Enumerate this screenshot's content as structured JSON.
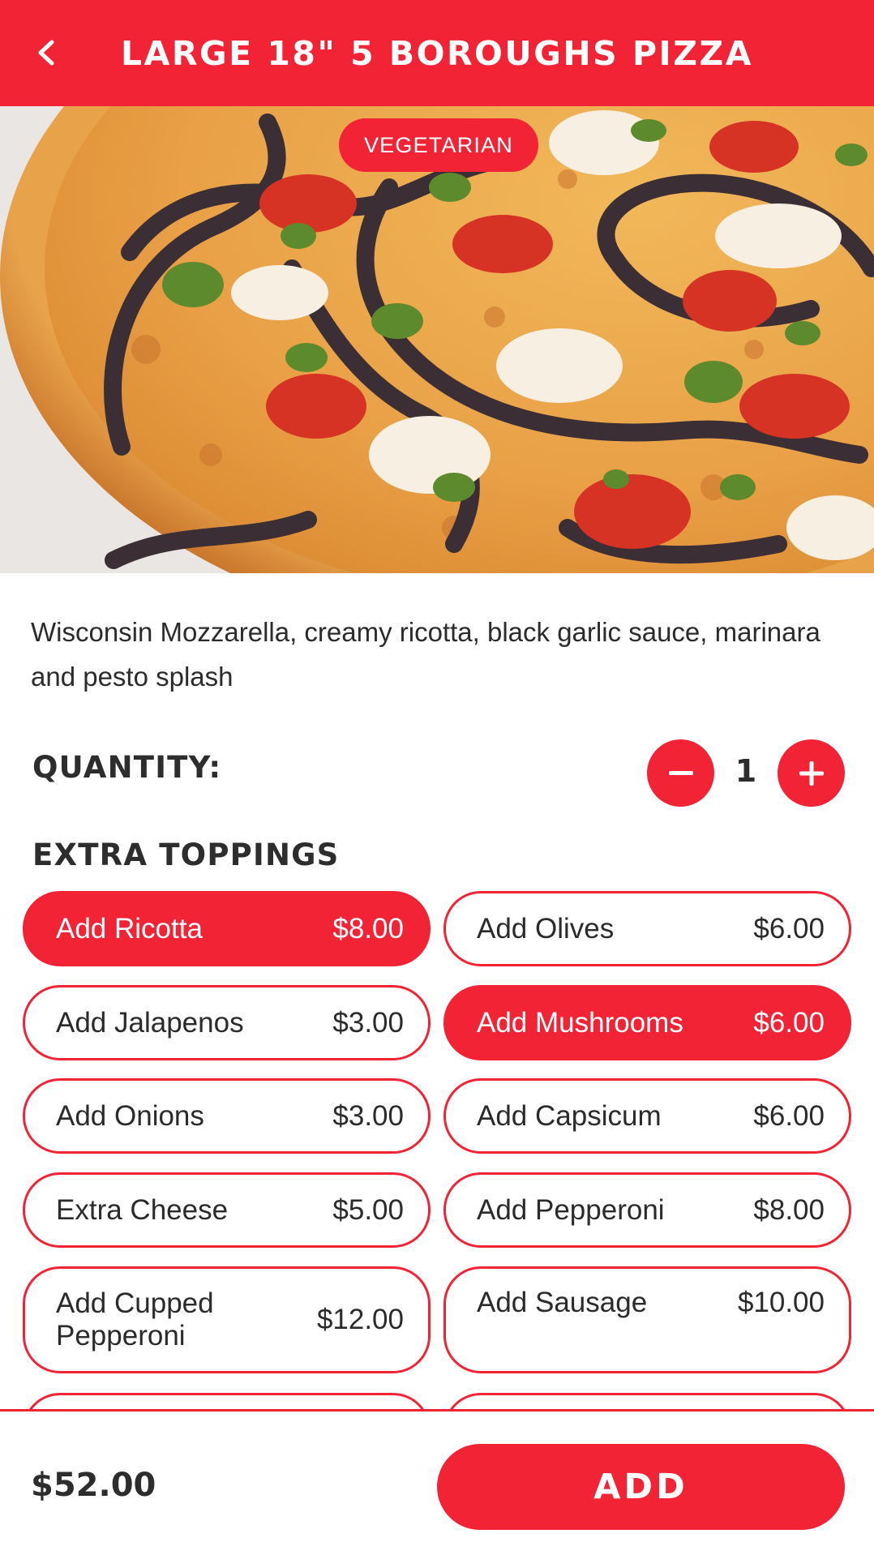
{
  "header": {
    "title": "LARGE 18\" 5 BOROUGHS PIZZA",
    "back_icon": "chevron-left-icon"
  },
  "badge": {
    "label": "VEGETARIAN"
  },
  "product": {
    "description": "Wisconsin Mozzarella, creamy ricotta, black garlic sauce, marinara and pesto splash"
  },
  "quantity": {
    "label": "QUANTITY:",
    "value": "1",
    "minus_icon": "minus-icon",
    "plus_icon": "plus-icon"
  },
  "toppings": {
    "title": "EXTRA TOPPINGS",
    "items": [
      {
        "name": "Add Ricotta",
        "price": "$8.00",
        "selected": true
      },
      {
        "name": "Add Olives",
        "price": "$6.00",
        "selected": false
      },
      {
        "name": "Add Jalapenos",
        "price": "$3.00",
        "selected": false
      },
      {
        "name": "Add Mushrooms",
        "price": "$6.00",
        "selected": true
      },
      {
        "name": "Add Onions",
        "price": "$3.00",
        "selected": false
      },
      {
        "name": "Add Capsicum",
        "price": "$6.00",
        "selected": false
      },
      {
        "name": "Extra Cheese",
        "price": "$5.00",
        "selected": false
      },
      {
        "name": "Add Pepperoni",
        "price": "$8.00",
        "selected": false
      },
      {
        "name": "Add Cupped Pepperoni",
        "price": "$12.00",
        "selected": false
      },
      {
        "name": "Add Sausage",
        "price": "$10.00",
        "selected": false
      }
    ]
  },
  "footer": {
    "total": "$52.00",
    "add_label": "ADD"
  },
  "colors": {
    "brand": "#f22335",
    "text": "#2b2b2b",
    "background": "#ffffff"
  }
}
